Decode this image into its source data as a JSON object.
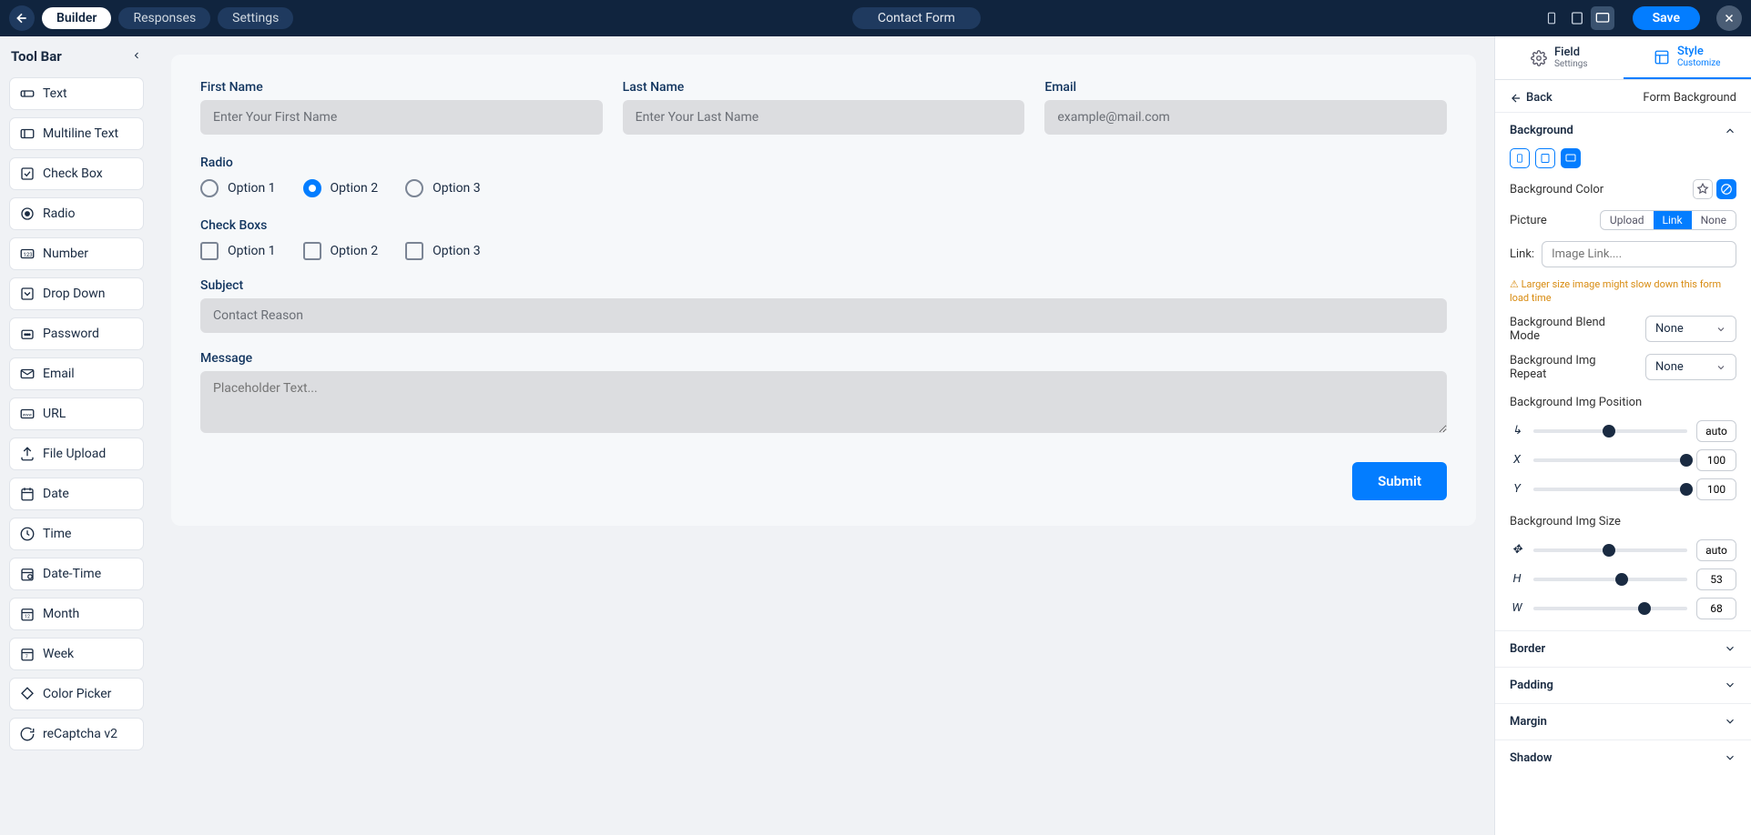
{
  "topbar": {
    "tabs": [
      "Builder",
      "Responses",
      "Settings"
    ],
    "active_tab": 0,
    "title": "Contact Form",
    "save": "Save"
  },
  "toolbar": {
    "title": "Tool Bar",
    "items": [
      {
        "label": "Text",
        "icon": "text"
      },
      {
        "label": "Multiline Text",
        "icon": "multiline"
      },
      {
        "label": "Check Box",
        "icon": "checkbox"
      },
      {
        "label": "Radio",
        "icon": "radio"
      },
      {
        "label": "Number",
        "icon": "number"
      },
      {
        "label": "Drop Down",
        "icon": "dropdown"
      },
      {
        "label": "Password",
        "icon": "password"
      },
      {
        "label": "Email",
        "icon": "email"
      },
      {
        "label": "URL",
        "icon": "url"
      },
      {
        "label": "File Upload",
        "icon": "upload"
      },
      {
        "label": "Date",
        "icon": "date"
      },
      {
        "label": "Time",
        "icon": "time"
      },
      {
        "label": "Date-Time",
        "icon": "datetime"
      },
      {
        "label": "Month",
        "icon": "month"
      },
      {
        "label": "Week",
        "icon": "week"
      },
      {
        "label": "Color Picker",
        "icon": "color"
      },
      {
        "label": "reCaptcha v2",
        "icon": "recaptcha"
      }
    ]
  },
  "form": {
    "first_name": {
      "label": "First Name",
      "placeholder": "Enter Your First Name"
    },
    "last_name": {
      "label": "Last Name",
      "placeholder": "Enter Your Last Name"
    },
    "email": {
      "label": "Email",
      "placeholder": "example@mail.com"
    },
    "radio": {
      "label": "Radio",
      "options": [
        "Option 1",
        "Option 2",
        "Option 3"
      ],
      "selected": 1
    },
    "checkboxes": {
      "label": "Check Boxs",
      "options": [
        "Option 1",
        "Option 2",
        "Option 3"
      ]
    },
    "subject": {
      "label": "Subject",
      "placeholder": "Contact Reason"
    },
    "message": {
      "label": "Message",
      "placeholder": "Placeholder Text..."
    },
    "submit": "Submit"
  },
  "right": {
    "tabs": [
      {
        "title": "Field",
        "sub": "Settings"
      },
      {
        "title": "Style",
        "sub": "Customize"
      }
    ],
    "active_tab": 1,
    "back": "Back",
    "crumb": "Form Background",
    "section_bg": "Background",
    "bg_color_label": "Background Color",
    "picture_label": "Picture",
    "picture_seg": [
      "Upload",
      "Link",
      "None"
    ],
    "picture_seg_active": 1,
    "link_label": "Link:",
    "link_placeholder": "Image Link....",
    "warn": "⚠ Larger size image might slow down this form load time",
    "blend_label": "Background Blend Mode",
    "blend_value": "None",
    "repeat_label": "Background Img Repeat",
    "repeat_value": "None",
    "pos_label": "Background Img Position",
    "pos_rows": [
      {
        "k": "↳",
        "v": "auto",
        "thumb_pct": 45
      },
      {
        "k": "X",
        "v": "100",
        "thumb_pct": 95
      },
      {
        "k": "Y",
        "v": "100",
        "thumb_pct": 95
      }
    ],
    "size_label": "Background Img Size",
    "size_rows": [
      {
        "k": "✥",
        "v": "auto",
        "thumb_pct": 45
      },
      {
        "k": "H",
        "v": "53",
        "thumb_pct": 53
      },
      {
        "k": "W",
        "v": "68",
        "thumb_pct": 68
      }
    ],
    "collapsed": [
      "Border",
      "Padding",
      "Margin",
      "Shadow"
    ]
  }
}
